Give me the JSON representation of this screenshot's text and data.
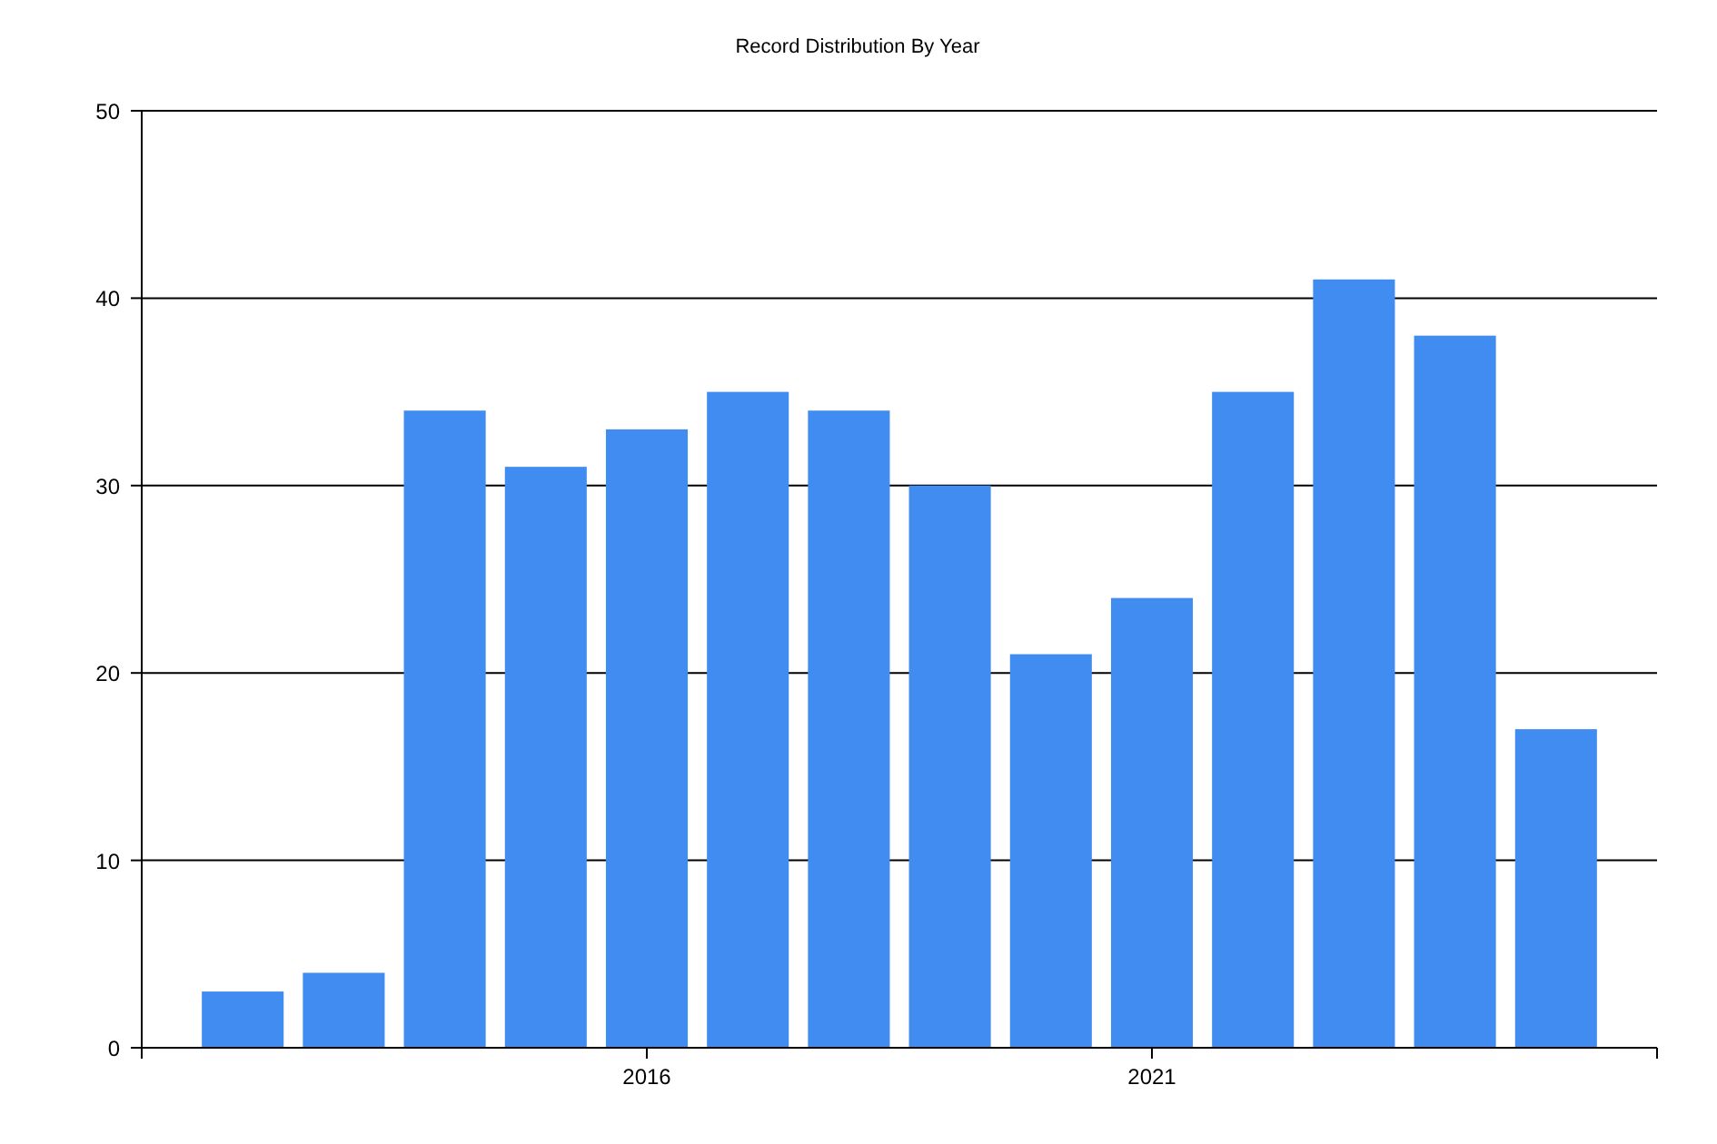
{
  "chart": {
    "chart_data": {
      "type": "bar",
      "title": "Record Distribution By Year",
      "x": [
        2012,
        2013,
        2014,
        2015,
        2016,
        2017,
        2018,
        2019,
        2020,
        2021,
        2022,
        2023,
        2024,
        2025
      ],
      "values": [
        3,
        4,
        34,
        31,
        33,
        35,
        34,
        30,
        21,
        24,
        35,
        41,
        38,
        17
      ],
      "xlim": [
        2011,
        2026
      ],
      "ylim": [
        0,
        50
      ],
      "xticks": [
        2016,
        2021
      ],
      "yticks": [
        0,
        10,
        20,
        30,
        40,
        50
      ],
      "grid": true
    }
  }
}
